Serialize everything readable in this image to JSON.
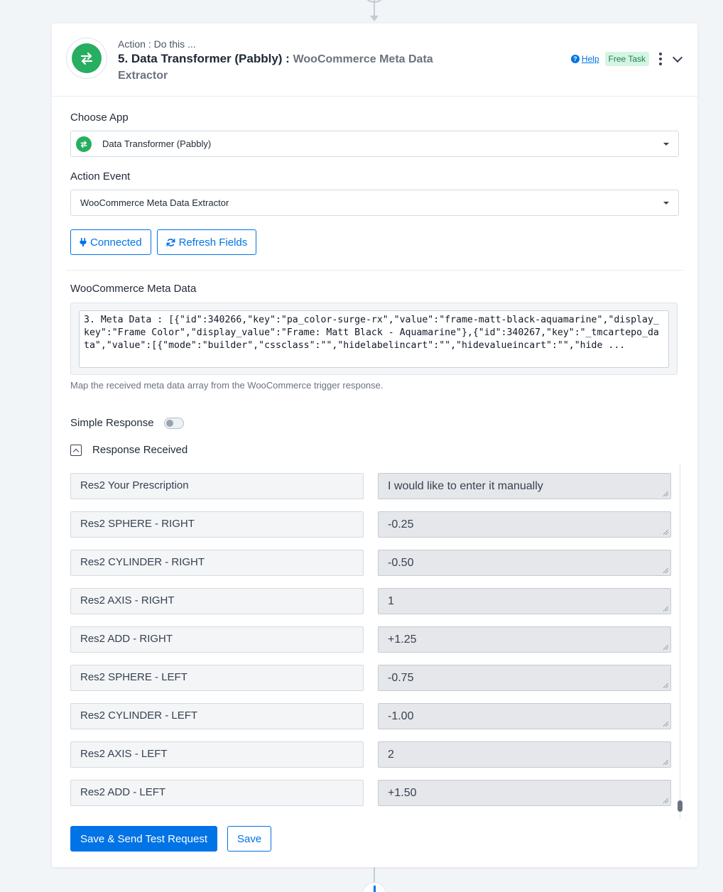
{
  "header": {
    "kicker": "Action : Do this ...",
    "step_title": "5. Data Transformer (Pabbly) :",
    "event_name": "WooCommerce Meta Data Extractor",
    "help_label": "Help",
    "badge_label": "Free Task"
  },
  "choose_app": {
    "label": "Choose App",
    "value": "Data Transformer (Pabbly)"
  },
  "action_event": {
    "label": "Action Event",
    "value": "WooCommerce Meta Data Extractor"
  },
  "buttons": {
    "connected_label": "Connected",
    "refresh_label": "Refresh Fields",
    "save_send_label": "Save & Send Test Request",
    "save_label": "Save"
  },
  "meta_data": {
    "label": "WooCommerce Meta Data",
    "value": "3. Meta Data : [{\"id\":340266,\"key\":\"pa_color-surge-rx\",\"value\":\"frame-matt-black-aquamarine\",\"display_key\":\"Frame Color\",\"display_value\":\"Frame: Matt Black - Aquamarine\"},{\"id\":340267,\"key\":\"_tmcartepo_data\",\"value\":[{\"mode\":\"builder\",\"cssclass\":\"\",\"hidelabelincart\":\"\",\"hidevalueincart\":\"\",\"hide ...",
    "help": "Map the received meta data array from the WooCommerce trigger response."
  },
  "simple_response": {
    "label": "Simple Response",
    "enabled": false
  },
  "response_received": {
    "label": "Response Received",
    "rows": [
      {
        "key": "Res2 Your Prescription",
        "value": "I would like to enter it manually"
      },
      {
        "key": "Res2 SPHERE - RIGHT",
        "value": "-0.25"
      },
      {
        "key": "Res2 CYLINDER - RIGHT",
        "value": "-0.50"
      },
      {
        "key": "Res2 AXIS - RIGHT",
        "value": "1"
      },
      {
        "key": "Res2 ADD - RIGHT",
        "value": "+1.25"
      },
      {
        "key": "Res2 SPHERE - LEFT",
        "value": "-0.75"
      },
      {
        "key": "Res2 CYLINDER - LEFT",
        "value": "-1.00"
      },
      {
        "key": "Res2 AXIS - LEFT",
        "value": "2"
      },
      {
        "key": "Res2 ADD - LEFT",
        "value": "+1.50"
      }
    ]
  },
  "colors": {
    "accent": "#0073e6",
    "app_green": "#27ae60",
    "badge_bg": "#d5f5e3"
  },
  "icons": {
    "app": "transfer-arrows-icon",
    "connected": "plug-icon",
    "refresh": "refresh-icon",
    "help": "question-circle-icon"
  }
}
